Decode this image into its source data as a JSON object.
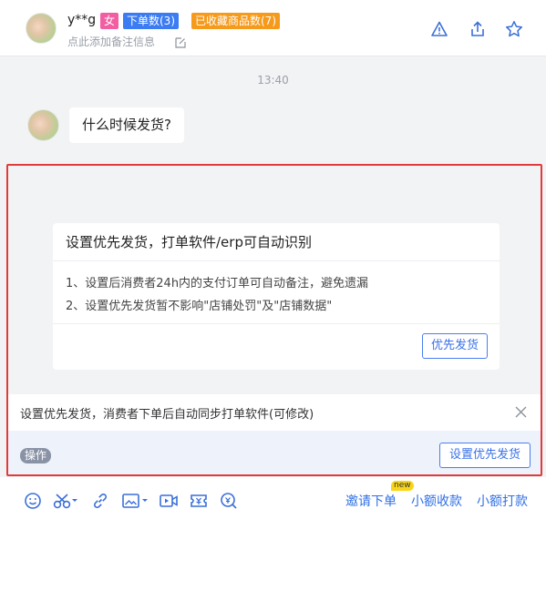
{
  "header": {
    "user_name": "y**g",
    "gender_badge": "女",
    "orders_badge": "下单数(3)",
    "favorites_badge": "已收藏商品数(7)",
    "note_placeholder": "点此添加备注信息",
    "icons": [
      "warning-icon",
      "share-icon",
      "star-icon"
    ]
  },
  "chat": {
    "timestamp": "13:40",
    "message": "什么时候发货?"
  },
  "card": {
    "title": "设置优先发货，打单软件/erp可自动识别",
    "line1": "1、设置后消费者24h内的支付订单可自动备注，避免遗漏",
    "line2": "2、设置优先发货暂不影响\"店铺处罚\"及\"店铺数据\"",
    "button": "优先发货"
  },
  "tipbar": {
    "text": "设置优先发货，消费者下单后自动同步打单软件(可修改)"
  },
  "actionbar": {
    "tag": "操作",
    "button": "设置优先发货"
  },
  "toolbar": {
    "invite_order": "邀请下单",
    "new_tag": "new",
    "small_payment": "小额收款",
    "small_transfer": "小额打款"
  },
  "colors": {
    "accent": "#3b72e8",
    "highlight": "#e23a3a",
    "gender": "#f25ea2",
    "orders": "#3b7cf3",
    "favorites": "#f59a1b"
  }
}
